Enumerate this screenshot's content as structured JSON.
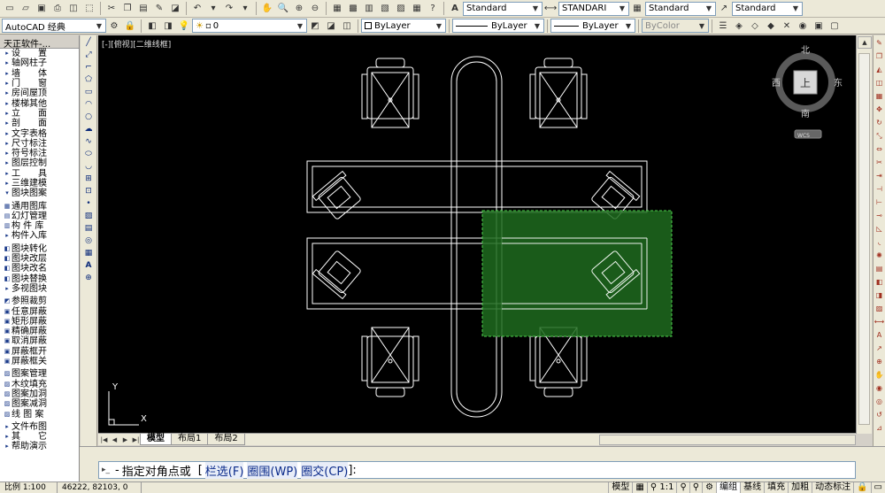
{
  "toolbar_row1": {
    "text_style": "Standard",
    "dim_style": "STANDARI",
    "table_style": "Standard",
    "mleader_style": "Standard"
  },
  "toolbar_row2": {
    "workspace": "AutoCAD 经典",
    "layer": "0",
    "color": "ByLayer",
    "linetype": "ByLayer",
    "lineweight": "ByLayer",
    "plotstyle": "ByColor"
  },
  "palette": {
    "title": "天正软件-...",
    "items": [
      {
        "label": "设　　置",
        "icon": "arrow-right"
      },
      {
        "label": "轴网柱子",
        "icon": "arrow-right"
      },
      {
        "label": "墙　　体",
        "icon": "arrow-right"
      },
      {
        "label": "门　　窗",
        "icon": "arrow-right"
      },
      {
        "label": "房间屋顶",
        "icon": "arrow-right"
      },
      {
        "label": "楼梯其他",
        "icon": "arrow-right"
      },
      {
        "label": "立　　面",
        "icon": "arrow-right"
      },
      {
        "label": "剖　　面",
        "icon": "arrow-right"
      },
      {
        "label": "文字表格",
        "icon": "arrow-right"
      },
      {
        "label": "尺寸标注",
        "icon": "arrow-right"
      },
      {
        "label": "符号标注",
        "icon": "arrow-right"
      },
      {
        "label": "图层控制",
        "icon": "arrow-right"
      },
      {
        "label": "工　　具",
        "icon": "arrow-right"
      },
      {
        "label": "三维建模",
        "icon": "arrow-right"
      },
      {
        "label": "图块图案",
        "icon": "arrow-down"
      },
      {
        "label": "通用图库",
        "icon": "library-icon"
      },
      {
        "label": "幻灯管理",
        "icon": "slide-icon"
      },
      {
        "label": "构 件 库",
        "icon": "component-icon"
      },
      {
        "label": "构件入库",
        "icon": "arrow-right"
      },
      {
        "label": "图块转化",
        "icon": "block-icon"
      },
      {
        "label": "图块改层",
        "icon": "block-icon"
      },
      {
        "label": "图块改名",
        "icon": "block-icon"
      },
      {
        "label": "图块替换",
        "icon": "block-icon"
      },
      {
        "label": "多视图块",
        "icon": "arrow-right"
      },
      {
        "label": "参照裁剪",
        "icon": "clip-icon"
      },
      {
        "label": "任意屏蔽",
        "icon": "mask-icon"
      },
      {
        "label": "矩形屏蔽",
        "icon": "mask-icon"
      },
      {
        "label": "精确屏蔽",
        "icon": "mask-icon"
      },
      {
        "label": "取消屏蔽",
        "icon": "mask-icon"
      },
      {
        "label": "屏蔽框开",
        "icon": "mask-icon"
      },
      {
        "label": "屏蔽框关",
        "icon": "mask-icon"
      },
      {
        "label": "图案管理",
        "icon": "pattern-icon"
      },
      {
        "label": "木纹填充",
        "icon": "pattern-icon"
      },
      {
        "label": "图案加洞",
        "icon": "pattern-icon"
      },
      {
        "label": "图案减洞",
        "icon": "pattern-icon"
      },
      {
        "label": "线 图 案",
        "icon": "pattern-icon"
      },
      {
        "label": "文件布图",
        "icon": "arrow-right"
      },
      {
        "label": "其　　它",
        "icon": "arrow-right"
      },
      {
        "label": "帮助演示",
        "icon": "arrow-right"
      }
    ]
  },
  "viewport": {
    "label": "[-][俯视][二维线框]"
  },
  "viewcube": {
    "north": "北",
    "south": "南",
    "east": "东",
    "west": "西",
    "top": "上",
    "wcs": "WCS"
  },
  "ucs": {
    "x": "X",
    "y": "Y"
  },
  "tabs": [
    {
      "label": "模型",
      "active": true
    },
    {
      "label": "布局1",
      "active": false
    },
    {
      "label": "布局2",
      "active": false
    }
  ],
  "command": {
    "prompt": "指定对角点或",
    "opt_open": "[",
    "opt1": "栏选(F)",
    "opt2": "圈围(WP)",
    "opt3": "圈交(CP)",
    "opt_close": "]:"
  },
  "status": {
    "scale": "比例 1:100",
    "coords": "46222, 82103, 0",
    "model": "模型",
    "annot_scale": "1:1",
    "buttons": [
      "编组",
      "基线",
      "填充",
      "加粗",
      "动态标注"
    ]
  },
  "colors": {
    "canvas_bg": "#000000",
    "geometry": "#ffffff",
    "selection_fill": "#1e6b1e",
    "selection_border": "#4fd24f"
  }
}
